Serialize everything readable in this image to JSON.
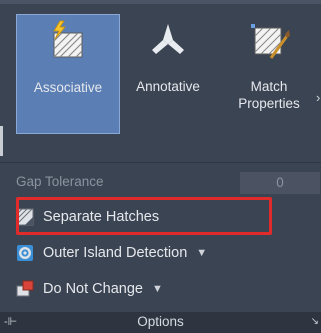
{
  "ribbon": {
    "buttons": [
      {
        "label": "Associative",
        "icon": "associative-hatch-icon",
        "active": true
      },
      {
        "label": "Annotative",
        "icon": "annotative-icon",
        "active": false
      },
      {
        "label": "Match\nProperties",
        "icon": "match-properties-icon",
        "active": false
      }
    ],
    "gap_tolerance": {
      "label": "Gap Tolerance",
      "value": "0"
    },
    "options": [
      {
        "label": "Separate Hatches",
        "icon": "separate-hatches-icon",
        "dropdown": false,
        "highlighted": true
      },
      {
        "label": "Outer Island Detection",
        "icon": "island-detection-icon",
        "dropdown": true
      },
      {
        "label": "Do Not Change",
        "icon": "draw-order-icon",
        "dropdown": true
      }
    ],
    "panel_title": "Options"
  },
  "colors": {
    "panel_bg": "#3b4453",
    "active_button": "#5b7fb5",
    "highlight_border": "#e12b2b",
    "footer_bg": "#2e3440"
  }
}
